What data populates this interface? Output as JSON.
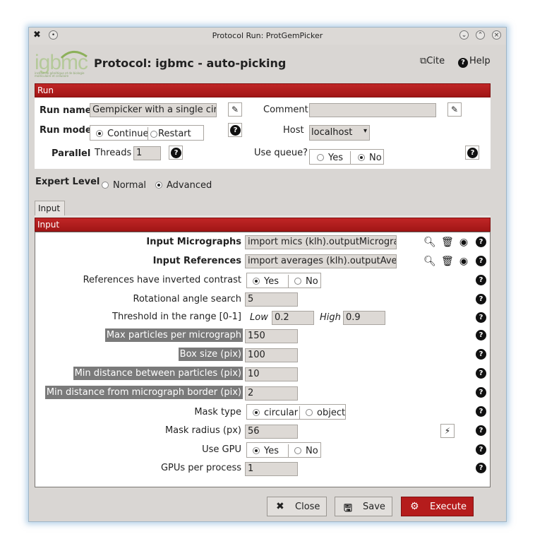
{
  "window": {
    "title": "Protocol Run: ProtGemPicker"
  },
  "header": {
    "logo_text": "igbmc",
    "logo_subtext": "institut de génétique et de biologie moléculaire et cellulaire",
    "protocol_title": "Protocol: igbmc - auto-picking",
    "cite_label": "Cite",
    "help_label": "Help"
  },
  "run_section": {
    "title": "Run",
    "run_name_label": "Run name",
    "run_name_value": "Gempicker with a single circul",
    "comment_label": "Comment",
    "comment_value": "",
    "run_mode_label": "Run mode",
    "run_mode_options": [
      "Continue",
      "Restart"
    ],
    "run_mode_selected": "Continue",
    "host_label": "Host",
    "host_value": "localhost",
    "parallel_label": "Parallel",
    "threads_label": "Threads",
    "threads_value": "1",
    "use_queue_label": "Use queue?",
    "use_queue_options": [
      "Yes",
      "No"
    ],
    "use_queue_selected": "No"
  },
  "expert": {
    "label": "Expert Level",
    "options": [
      "Normal",
      "Advanced"
    ],
    "selected": "Advanced"
  },
  "tabs": [
    {
      "label": "Input"
    }
  ],
  "input_section": {
    "title": "Input",
    "input_micrographs_label": "Input Micrographs",
    "input_micrographs_value": "import mics (klh).outputMicrographs.",
    "input_references_label": "Input References",
    "input_references_value": "import averages (klh).outputAverage",
    "inverted_label": "References have inverted contrast",
    "inverted_options": [
      "Yes",
      "No"
    ],
    "inverted_selected": "Yes",
    "rot_label": "Rotational angle search",
    "rot_value": "5",
    "threshold_label": "Threshold in the range [0-1]",
    "threshold_low_label": "Low",
    "threshold_low_value": "0.2",
    "threshold_high_label": "High",
    "threshold_high_value": "0.9",
    "max_particles_label": "Max particles per micrograph",
    "max_particles_value": "150",
    "box_size_label": "Box size (pix)",
    "box_size_value": "100",
    "min_dist_particles_label": "Min distance between particles (pix)",
    "min_dist_particles_value": "10",
    "min_dist_border_label": "Min distance from micrograph border (pix)",
    "min_dist_border_value": "2",
    "mask_type_label": "Mask type",
    "mask_type_options": [
      "circular",
      "object"
    ],
    "mask_type_selected": "circular",
    "mask_radius_label": "Mask radius (px)",
    "mask_radius_value": "56",
    "use_gpu_label": "Use GPU",
    "use_gpu_options": [
      "Yes",
      "No"
    ],
    "use_gpu_selected": "Yes",
    "gpus_label": "GPUs per process",
    "gpus_value": "1"
  },
  "footer": {
    "close_label": "Close",
    "save_label": "Save",
    "execute_label": "Execute"
  },
  "colors": {
    "section_red": "#b51c1c",
    "logo_green": "#b5c99a"
  }
}
